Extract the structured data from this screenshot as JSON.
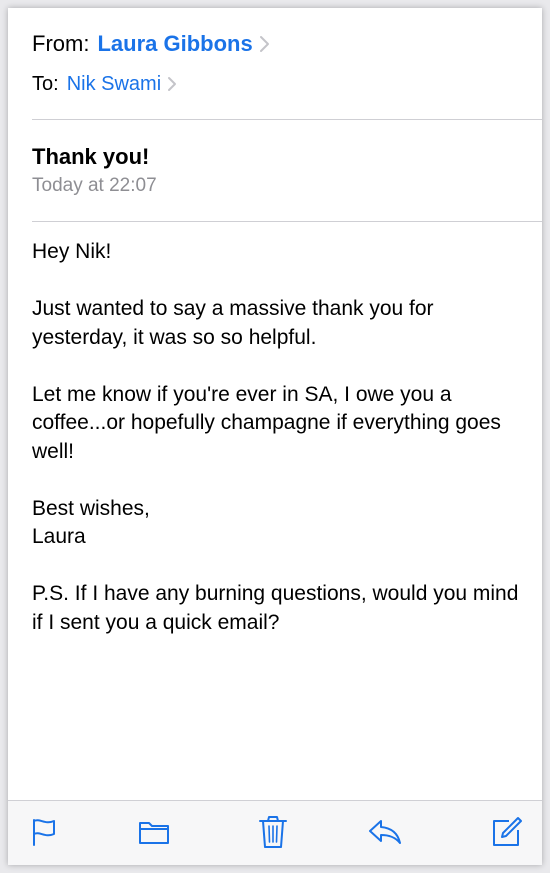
{
  "header": {
    "from_label": "From:",
    "from_name": "Laura Gibbons",
    "to_label": "To:",
    "to_name": "Nik Swami"
  },
  "message": {
    "subject": "Thank you!",
    "date": "Today at 22:07",
    "greeting": "Hey Nik!",
    "paragraph1": "Just wanted to say a massive thank you for yesterday, it was so so helpful.",
    "paragraph2": "Let me know if you're ever in SA, I owe you a coffee...or hopefully champagne if everything goes well!",
    "signoff": "Best wishes,",
    "signature": "Laura",
    "postscript": "P.S. If I have any burning questions, would you mind if I sent you a quick email?"
  },
  "toolbar": {
    "icons": [
      "flag-icon",
      "folder-icon",
      "trash-icon",
      "reply-icon",
      "compose-icon"
    ]
  },
  "colors": {
    "accent": "#1a73e8",
    "secondary_text": "#8e8e93",
    "chevron": "#c4c4c9"
  }
}
